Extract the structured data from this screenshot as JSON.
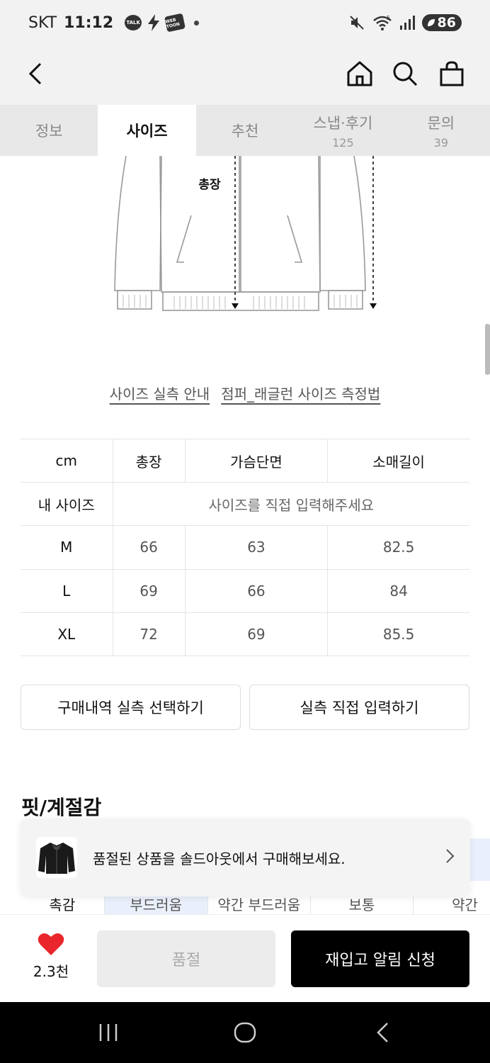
{
  "status_bar": {
    "carrier": "SKT",
    "time": "11:12",
    "talk_icon_text": "TALK",
    "webtoon_icon_text": "WEB TOON",
    "signal_badge": "5",
    "battery": "86"
  },
  "tabs": [
    {
      "label": "정보",
      "count": ""
    },
    {
      "label": "사이즈",
      "count": ""
    },
    {
      "label": "추천",
      "count": ""
    },
    {
      "label": "스냅·후기",
      "count": "125"
    },
    {
      "label": "문의",
      "count": "39"
    }
  ],
  "illustration": {
    "label": "총장"
  },
  "guide_links": [
    "사이즈 실측 안내",
    "점퍼_래글런 사이즈 측정법"
  ],
  "size_table": {
    "headers": [
      "cm",
      "총장",
      "가슴단면",
      "소매길이"
    ],
    "my_size_label": "내 사이즈",
    "my_size_placeholder": "사이즈를 직접 입력해주세요",
    "rows": [
      {
        "size": "M",
        "values": [
          "66",
          "63",
          "82.5"
        ]
      },
      {
        "size": "L",
        "values": [
          "69",
          "66",
          "84"
        ]
      },
      {
        "size": "XL",
        "values": [
          "72",
          "69",
          "85.5"
        ]
      }
    ]
  },
  "buttons": {
    "purchase_history": "구매내역 실측 선택하기",
    "direct_input": "실측 직접 입력하기"
  },
  "fit": {
    "title": "핏/계절감",
    "row_label": "촉감",
    "options": [
      "부드러움",
      "약간 부드러움",
      "보통",
      "약간"
    ]
  },
  "toast": {
    "text": "품절된 상품을 솔드아웃에서 구매해보세요."
  },
  "bottom": {
    "like_count": "2.3천",
    "soldout_label": "품절",
    "restock_label": "재입고 알림 신청"
  },
  "colors": {
    "accent": "#000000",
    "heart": "#e8262b",
    "selected_cell": "#eaf0fb"
  }
}
